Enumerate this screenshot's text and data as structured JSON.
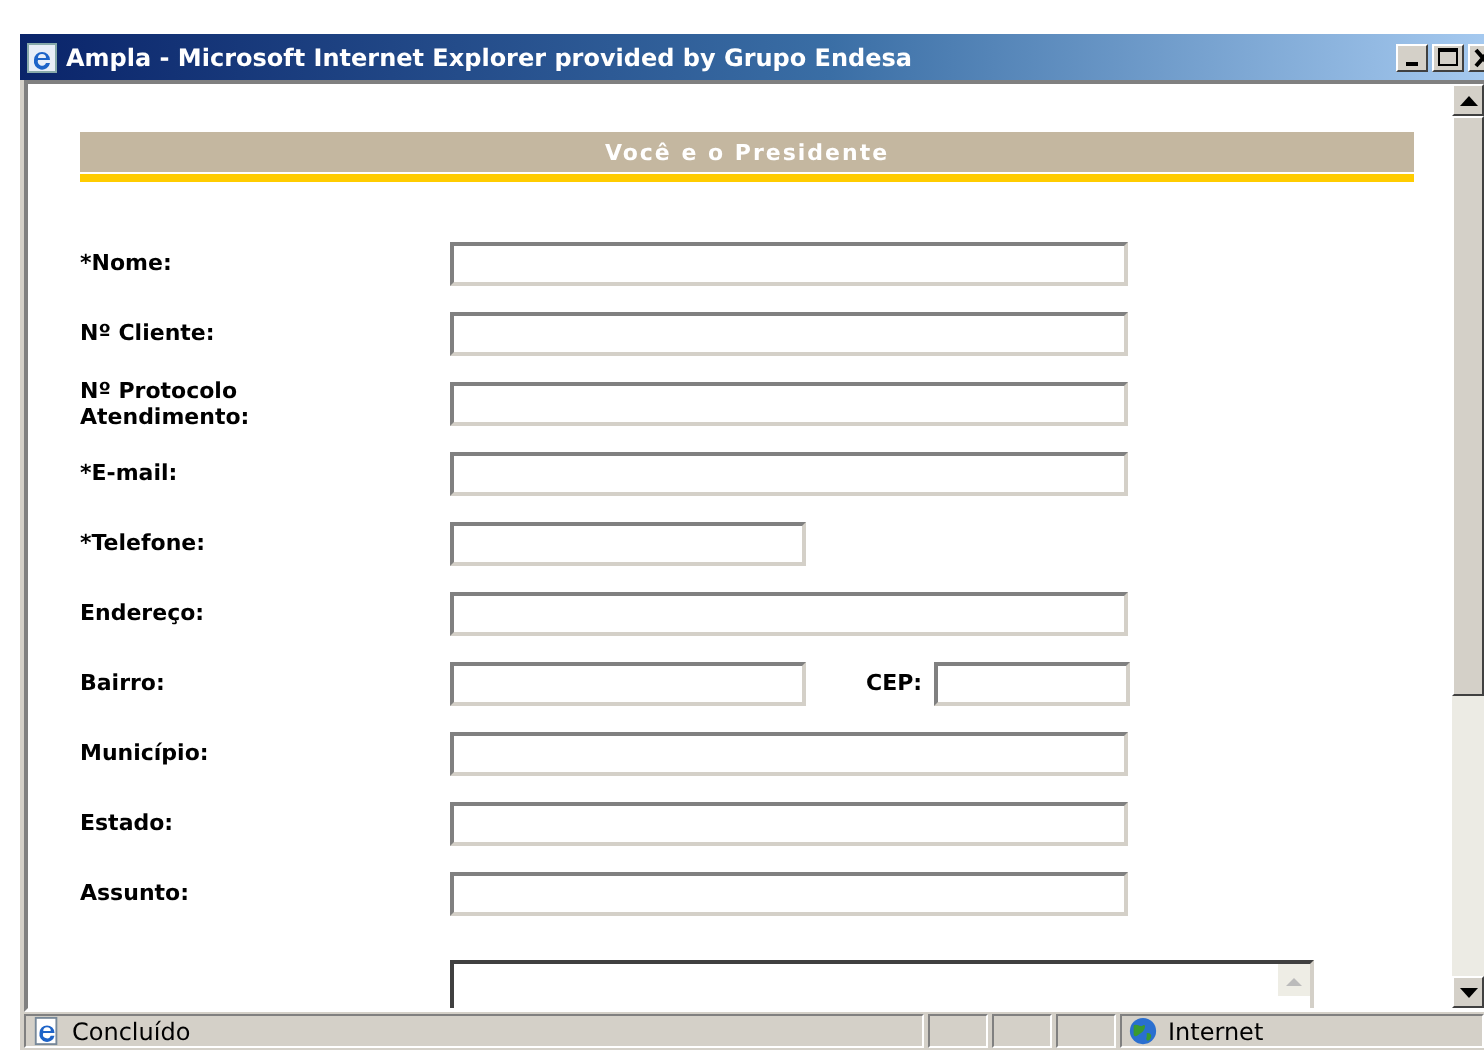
{
  "window": {
    "title": "Ampla - Microsoft Internet Explorer provided by Grupo Endesa"
  },
  "form": {
    "heading": "Você e o Presidente",
    "fields": [
      {
        "label": "*Nome:",
        "kind": "wide"
      },
      {
        "label": "Nº Cliente:",
        "kind": "wide"
      },
      {
        "label": "Nº Protocolo Atendimento:",
        "kind": "wide"
      },
      {
        "label": "*E-mail:",
        "kind": "wide"
      },
      {
        "label": "*Telefone:",
        "kind": "short"
      },
      {
        "label": "Endereço:",
        "kind": "wide"
      },
      {
        "label": "Bairro:",
        "kind": "pair",
        "second_label": "CEP:"
      },
      {
        "label": "Município:",
        "kind": "wide"
      },
      {
        "label": "Estado:",
        "kind": "wide"
      },
      {
        "label": "Assunto:",
        "kind": "wide"
      },
      {
        "kind": "textarea"
      }
    ]
  },
  "status_bar": {
    "text": "Concluído",
    "zone": "Internet"
  }
}
